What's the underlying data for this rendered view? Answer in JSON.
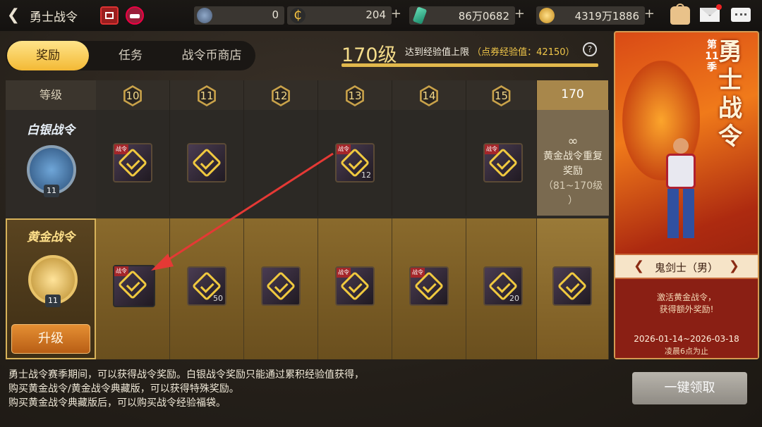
{
  "header": {
    "title": "勇士战令",
    "icon_calendar": "calendar-icon",
    "icon_level": "level-badge-icon"
  },
  "currencies": [
    {
      "icon": "token-icon",
      "value": "0",
      "plus": ""
    },
    {
      "icon": "c-coin-icon",
      "value": "204",
      "plus": "+"
    },
    {
      "icon": "gem-icon",
      "value": "86万0682",
      "plus": "+"
    },
    {
      "icon": "gold-coin-icon",
      "value": "4319万1886",
      "plus": "+"
    }
  ],
  "right_icons": [
    "bag-icon",
    "mail-icon",
    "chat-icon"
  ],
  "tabs": [
    {
      "label": "奖励"
    },
    {
      "label": "任务"
    },
    {
      "label": "战令币商店"
    }
  ],
  "level": {
    "text": "170级",
    "note_prefix": "达到经验值上限",
    "note_suffix": "（点券经验值：42150）",
    "help": "?"
  },
  "grid": {
    "header_label": "等级",
    "levels": [
      "10",
      "11",
      "12",
      "13",
      "14",
      "15"
    ],
    "max_level": "170",
    "silver": {
      "name": "白银战令",
      "badge": "11"
    },
    "gold": {
      "name": "黄金战令",
      "badge": "11",
      "upgrade": "升级"
    },
    "silver_items": [
      {
        "has": true,
        "qty": ""
      },
      {
        "has": true,
        "qty": ""
      },
      {
        "has": false,
        "qty": ""
      },
      {
        "has": true,
        "qty": "12"
      },
      {
        "has": false,
        "qty": ""
      },
      {
        "has": true,
        "qty": ""
      }
    ],
    "gold_items": [
      {
        "qty": ""
      },
      {
        "qty": "50"
      },
      {
        "qty": ""
      },
      {
        "qty": ""
      },
      {
        "qty": ""
      },
      {
        "qty": "20"
      }
    ],
    "repeat": {
      "sym": "∞",
      "line1": "黄金战令重复",
      "line2": "奖励",
      "line3": "（81~170级",
      "line4": "）"
    }
  },
  "item_tag": "战令",
  "notes": [
    "勇士战令赛季期间，可以获得战令奖励。白银战令奖励只能通过累积经验值获得，",
    "购买黄金战令/黄金战令典藏版，可以获得特殊奖励。",
    "购买黄金战令典藏版后，可以购买战令经验福袋。"
  ],
  "claim": "一键领取",
  "poster": {
    "title": "勇士战令",
    "season_1": "第",
    "season_2": "11",
    "season_3": "季",
    "char": "鬼剑士（男）",
    "activate_1": "激活黄金战令，",
    "activate_2": "获得额外奖励!",
    "date": "2026-01-14~2026-03-18",
    "ends": "凌晨6点为止"
  },
  "colors": {
    "gold": "#f3b935",
    "accent_orange": "#e58f33",
    "arrow": "#e53935"
  }
}
